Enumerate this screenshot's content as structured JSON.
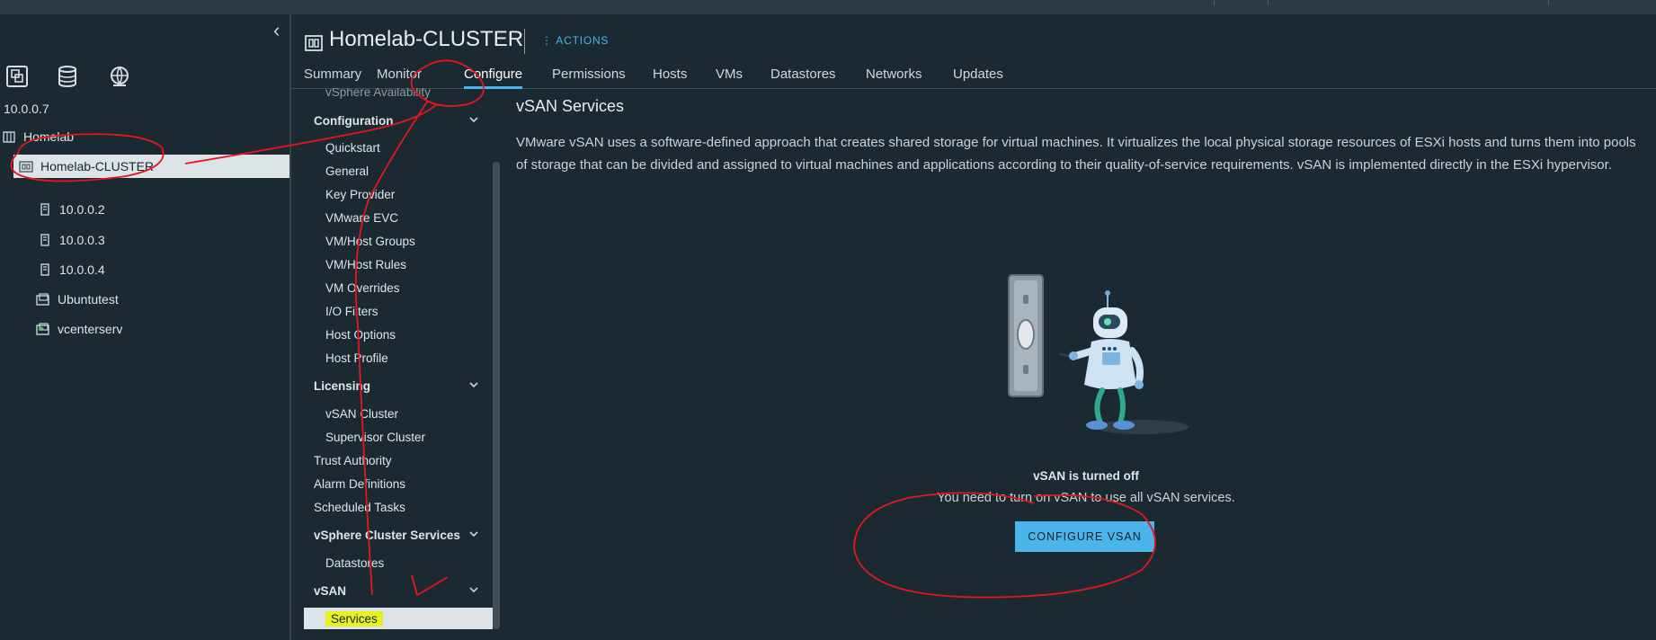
{
  "left_nav": {
    "collapse_icon": "chevron-left-icon",
    "view_icons": [
      "hosts-clusters-icon",
      "storage-icon",
      "network-icon"
    ],
    "tree": [
      {
        "label": "10.0.0.7",
        "icon": "vcenter-icon"
      },
      {
        "label": "Homelab",
        "icon": "datacenter-icon"
      },
      {
        "label": "Homelab-CLUSTER",
        "icon": "cluster-icon",
        "selected": true
      },
      {
        "label": "10.0.0.2",
        "icon": "host-icon"
      },
      {
        "label": "10.0.0.3",
        "icon": "host-icon"
      },
      {
        "label": "10.0.0.4",
        "icon": "host-icon"
      },
      {
        "label": "Ubuntutest",
        "icon": "vm-icon"
      },
      {
        "label": "vcenterserv",
        "icon": "vm-icon"
      }
    ]
  },
  "header": {
    "title": "Homelab-CLUSTER",
    "actions_label": "ACTIONS",
    "tabs": [
      "Summary",
      "Monitor",
      "Configure",
      "Permissions",
      "Hosts",
      "VMs",
      "Datastores",
      "Networks",
      "Updates"
    ],
    "active_tab": "Configure"
  },
  "settings_nav": {
    "partial_item": "vSphere Availability",
    "groups": [
      {
        "label": "Configuration",
        "items": [
          "Quickstart",
          "General",
          "Key Provider",
          "VMware EVC",
          "VM/Host Groups",
          "VM/Host Rules",
          "VM Overrides",
          "I/O Filters",
          "Host Options",
          "Host Profile"
        ]
      },
      {
        "label": "Licensing",
        "items": [
          "vSAN Cluster",
          "Supervisor Cluster"
        ]
      }
    ],
    "top_items": [
      "Trust Authority",
      "Alarm Definitions",
      "Scheduled Tasks"
    ],
    "groups2": [
      {
        "label": "vSphere Cluster Services",
        "items": [
          "Datastores"
        ]
      },
      {
        "label": "vSAN",
        "items": [
          "Services"
        ]
      }
    ],
    "selected": "Services"
  },
  "content": {
    "section_title": "vSAN Services",
    "description": "VMware vSAN uses a software-defined approach that creates shared storage for virtual machines. It virtualizes the local physical storage resources of ESXi hosts and turns them into pools of storage that can be divided and assigned to virtual machines and applications according to their quality-of-service requirements. vSAN is implemented directly in the ESXi hypervisor.",
    "empty_state_title": "vSAN is turned off",
    "empty_state_message": "You need to turn on vSAN to use all vSAN services.",
    "configure_button": "CONFIGURE VSAN"
  },
  "colors": {
    "background": "#1b2a32",
    "accent": "#49b5e8",
    "selection": "#dce4e8",
    "highlight": "#e8f024",
    "annotation": "#e8141e"
  }
}
